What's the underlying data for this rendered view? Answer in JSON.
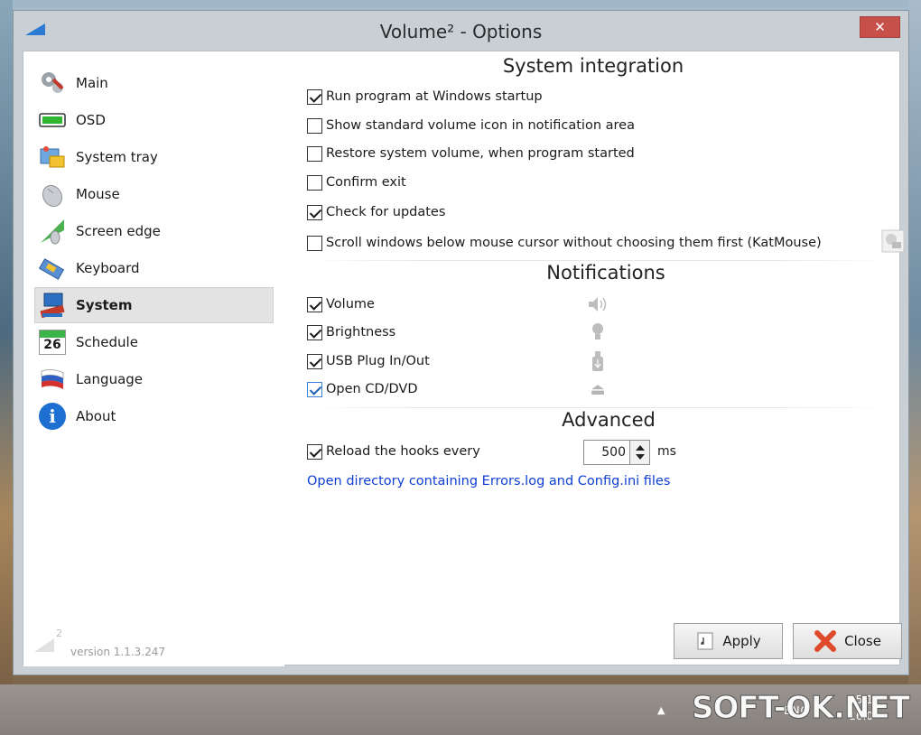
{
  "window": {
    "title": "Volume² - Options",
    "close_glyph": "✕"
  },
  "sidebar": {
    "items": [
      {
        "label": "Main",
        "icon": "gears-icon"
      },
      {
        "label": "OSD",
        "icon": "osd-bar-icon"
      },
      {
        "label": "System tray",
        "icon": "system-tray-icon"
      },
      {
        "label": "Mouse",
        "icon": "mouse-icon"
      },
      {
        "label": "Screen edge",
        "icon": "screen-edge-icon"
      },
      {
        "label": "Keyboard",
        "icon": "keyboard-icon"
      },
      {
        "label": "System",
        "icon": "system-icon",
        "active": true
      },
      {
        "label": "Schedule",
        "icon": "calendar-icon",
        "day": "26"
      },
      {
        "label": "Language",
        "icon": "flag-icon"
      },
      {
        "label": "About",
        "icon": "info-icon",
        "glyph": "i"
      }
    ],
    "version": "version 1.1.3.247",
    "logo_sup": "2"
  },
  "system_integration": {
    "title": "System integration",
    "options": [
      {
        "label": "Run program at Windows startup",
        "checked": true
      },
      {
        "label": "Show standard volume icon in notification area",
        "checked": false
      },
      {
        "label": "Restore system volume, when program started",
        "checked": false
      },
      {
        "label": "Confirm exit",
        "checked": false
      },
      {
        "label": "Check for updates",
        "checked": true
      },
      {
        "label": "Scroll windows below mouse cursor without choosing them first (KatMouse)",
        "checked": false
      }
    ]
  },
  "notifications": {
    "title": "Notifications",
    "options": [
      {
        "label": "Volume",
        "checked": true,
        "icon": "speaker-icon"
      },
      {
        "label": "Brightness",
        "checked": true,
        "icon": "bulb-icon"
      },
      {
        "label": "USB Plug In/Out",
        "checked": true,
        "icon": "usb-icon"
      },
      {
        "label": "Open CD/DVD",
        "checked": true,
        "icon": "eject-icon",
        "glyph": "⏏"
      }
    ]
  },
  "advanced": {
    "title": "Advanced",
    "reload_label": "Reload the hooks every",
    "reload_checked": true,
    "reload_value": "500",
    "reload_unit": "ms",
    "link": "Open directory containing Errors.log and Config.ini files"
  },
  "buttons": {
    "apply": "Apply",
    "close": "Close"
  },
  "taskbar": {
    "tray_arrow": "▲",
    "lang": "ENG",
    "time": "15:1",
    "date": "16.0",
    "watermark": "SOFT-OK.NET"
  },
  "colors": {
    "accent": "#1f5fb8",
    "link": "#0f3ed6",
    "close_red": "#c7504a"
  }
}
